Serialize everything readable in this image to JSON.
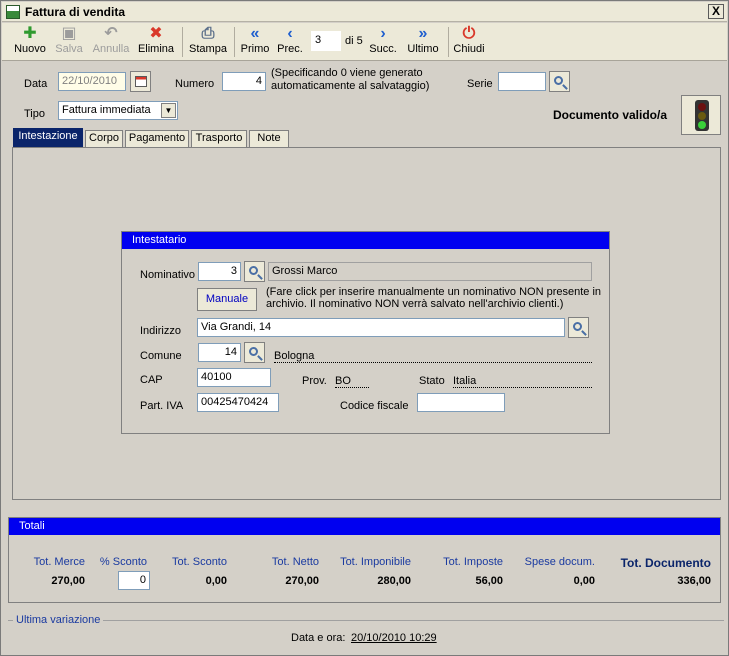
{
  "window": {
    "title": "Fattura di vendita",
    "close_label": "X"
  },
  "toolbar": {
    "nuovo": "Nuovo",
    "salva": "Salva",
    "annulla": "Annulla",
    "elimina": "Elimina",
    "stampa": "Stampa",
    "primo": "Primo",
    "prec": "Prec.",
    "page_value": "3",
    "page_of": "di 5",
    "succ": "Succ.",
    "ultimo": "Ultimo",
    "chiudi": "Chiudi"
  },
  "header": {
    "data_label": "Data",
    "data_value": "22/10/2010",
    "numero_label": "Numero",
    "numero_value": "4",
    "numero_hint_1": "(Specificando 0 viene generato",
    "numero_hint_2": "automaticamente al salvataggio)",
    "serie_label": "Serie",
    "serie_value": "",
    "tipo_label": "Tipo",
    "tipo_value": "Fattura immediata",
    "status_text": "Documento valido/a"
  },
  "tabs": [
    "Intestazione",
    "Corpo",
    "Pagamento",
    "Trasporto",
    "Note"
  ],
  "intestatario": {
    "title": "Intestatario",
    "nominativo_label": "Nominativo",
    "nominativo_code": "3",
    "nominativo_name": "Grossi Marco",
    "manuale_label": "Manuale",
    "manuale_hint_1": "(Fare click per inserire manualmente un nominativo NON presente in",
    "manuale_hint_2": "archivio. Il nominativo NON verrà salvato nell'archivio clienti.)",
    "indirizzo_label": "Indirizzo",
    "indirizzo_value": "Via Grandi, 14",
    "comune_label": "Comune",
    "comune_code": "14",
    "comune_name": "Bologna",
    "cap_label": "CAP",
    "cap_value": "40100",
    "prov_label": "Prov.",
    "prov_value": "BO",
    "stato_label": "Stato",
    "stato_value": "Italia",
    "piva_label": "Part. IVA",
    "piva_value": "00425470424",
    "cf_label": "Codice fiscale",
    "cf_value": ""
  },
  "totali": {
    "title": "Totali",
    "headers": [
      "Tot. Merce",
      "% Sconto",
      "Tot. Sconto",
      "Tot. Netto",
      "Tot. Imponibile",
      "Tot. Imposte",
      "Spese docum.",
      "Tot. Documento"
    ],
    "tot_merce": "270,00",
    "sconto_pct": "0",
    "tot_sconto": "0,00",
    "tot_netto": "270,00",
    "tot_imponibile": "280,00",
    "tot_imposte": "56,00",
    "spese": "0,00",
    "tot_documento": "336,00"
  },
  "ultima_variazione": {
    "title": "Ultima variazione",
    "label": "Data e ora:",
    "value": "20/10/2010 10:29"
  }
}
